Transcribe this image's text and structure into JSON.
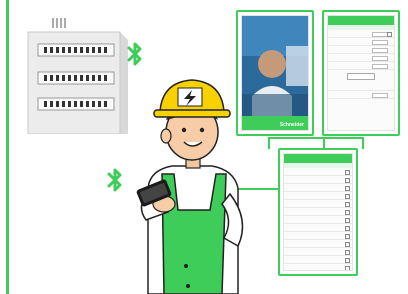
{
  "colors": {
    "brand_green": "#3dcd58",
    "helmet_yellow": "#f8d100",
    "panel_grey": "#e7e7e7",
    "line_green": "#3dcd58"
  },
  "icons": [
    "bluetooth-icon",
    "lightning-bolt-icon",
    "electrical-panel",
    "phone-screen"
  ],
  "phone_photo": {
    "brand_text": "Schneider"
  }
}
